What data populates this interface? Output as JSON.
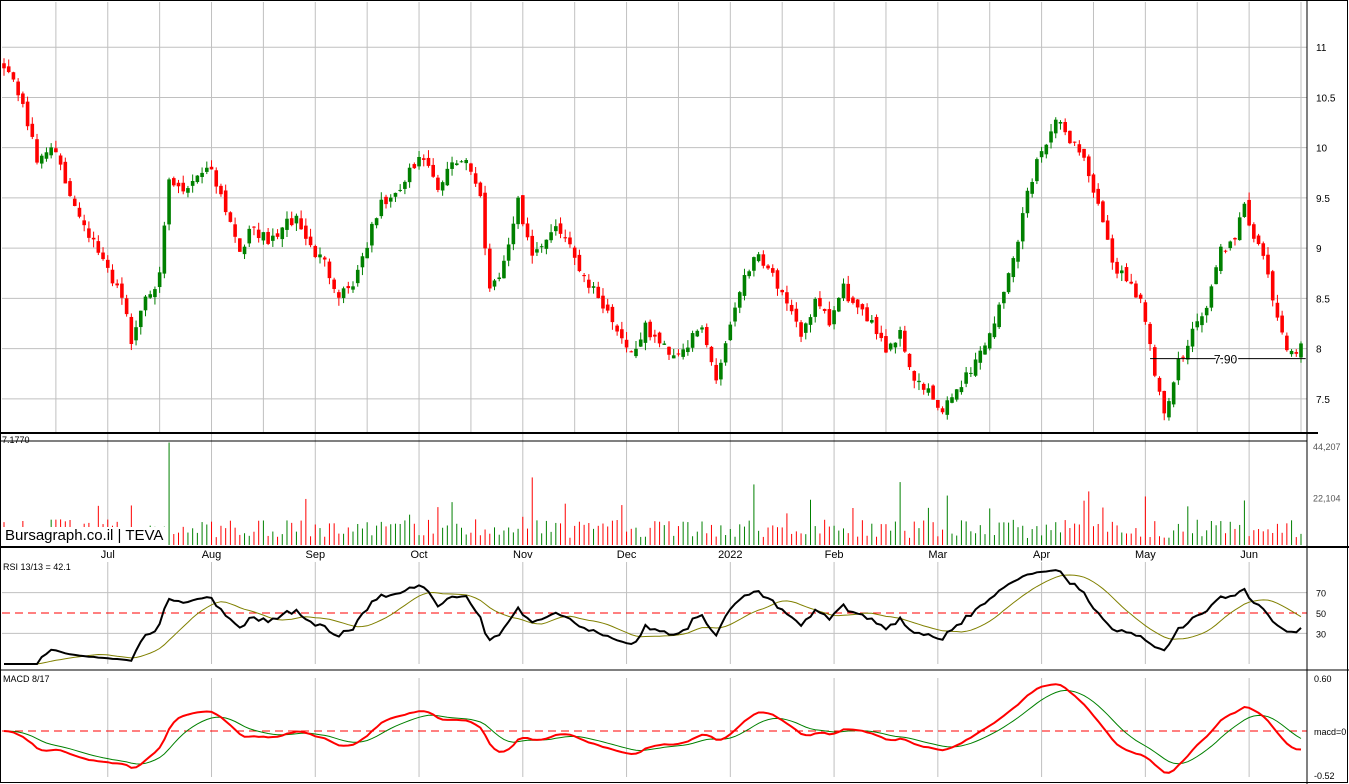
{
  "chart_data": [
    {
      "type": "candlestick",
      "ticker": "TEVA",
      "y_ticks": [
        "11",
        "10.5",
        "10",
        "9.5",
        "9",
        "8.5",
        "8",
        "7.5"
      ],
      "ylim": [
        7.17,
        11.45
      ],
      "low_label": "7.1770",
      "marker": {
        "label": "7.90",
        "value": 7.9
      },
      "x_labels": [
        "Jul",
        "Aug",
        "Sep",
        "Oct",
        "Nov",
        "Dec",
        "2022",
        "Feb",
        "Mar",
        "Apr",
        "May",
        "Jun"
      ],
      "x_label_days": [
        22,
        44,
        66,
        88,
        110,
        132,
        154,
        176,
        198,
        220,
        242,
        264
      ],
      "anchors": [
        [
          0,
          10.85
        ],
        [
          4,
          10.45
        ],
        [
          7,
          9.85
        ],
        [
          10,
          10.05
        ],
        [
          13,
          9.65
        ],
        [
          17,
          9.25
        ],
        [
          21,
          8.85
        ],
        [
          25,
          8.55
        ],
        [
          27,
          8.05
        ],
        [
          30,
          8.55
        ],
        [
          33,
          8.7
        ],
        [
          35,
          9.65
        ],
        [
          38,
          9.55
        ],
        [
          41,
          9.75
        ],
        [
          44,
          9.8
        ],
        [
          47,
          9.4
        ],
        [
          50,
          9.0
        ],
        [
          53,
          9.2
        ],
        [
          56,
          9.05
        ],
        [
          59,
          9.2
        ],
        [
          62,
          9.3
        ],
        [
          65,
          9.0
        ],
        [
          68,
          8.85
        ],
        [
          71,
          8.55
        ],
        [
          74,
          8.65
        ],
        [
          77,
          9.05
        ],
        [
          80,
          9.45
        ],
        [
          83,
          9.5
        ],
        [
          86,
          9.75
        ],
        [
          89,
          9.9
        ],
        [
          92,
          9.55
        ],
        [
          95,
          9.85
        ],
        [
          98,
          9.9
        ],
        [
          101,
          9.5
        ],
        [
          103,
          8.6
        ],
        [
          106,
          8.85
        ],
        [
          109,
          9.45
        ],
        [
          112,
          8.95
        ],
        [
          115,
          9.1
        ],
        [
          118,
          9.2
        ],
        [
          121,
          8.9
        ],
        [
          124,
          8.65
        ],
        [
          127,
          8.45
        ],
        [
          130,
          8.2
        ],
        [
          133,
          7.95
        ],
        [
          136,
          8.2
        ],
        [
          139,
          8.05
        ],
        [
          142,
          7.95
        ],
        [
          145,
          8.05
        ],
        [
          148,
          8.2
        ],
        [
          151,
          7.7
        ],
        [
          154,
          8.25
        ],
        [
          157,
          8.75
        ],
        [
          160,
          8.95
        ],
        [
          163,
          8.75
        ],
        [
          166,
          8.4
        ],
        [
          169,
          8.15
        ],
        [
          172,
          8.45
        ],
        [
          175,
          8.25
        ],
        [
          178,
          8.6
        ],
        [
          181,
          8.35
        ],
        [
          184,
          8.3
        ],
        [
          187,
          8.0
        ],
        [
          190,
          8.15
        ],
        [
          193,
          7.7
        ],
        [
          196,
          7.55
        ],
        [
          199,
          7.35
        ],
        [
          202,
          7.6
        ],
        [
          205,
          7.8
        ],
        [
          208,
          8.05
        ],
        [
          211,
          8.4
        ],
        [
          214,
          8.9
        ],
        [
          217,
          9.55
        ],
        [
          220,
          10.0
        ],
        [
          223,
          10.25
        ],
        [
          226,
          10.1
        ],
        [
          229,
          9.9
        ],
        [
          232,
          9.4
        ],
        [
          235,
          8.85
        ],
        [
          238,
          8.7
        ],
        [
          241,
          8.5
        ],
        [
          244,
          7.75
        ],
        [
          246,
          7.3
        ],
        [
          249,
          7.85
        ],
        [
          252,
          8.2
        ],
        [
          255,
          8.4
        ],
        [
          258,
          9.0
        ],
        [
          261,
          9.05
        ],
        [
          263,
          9.45
        ],
        [
          265,
          9.1
        ],
        [
          268,
          8.75
        ],
        [
          270,
          8.25
        ],
        [
          272,
          8.0
        ]
      ]
    },
    {
      "type": "bar",
      "name": "volume",
      "y_ticks": [
        "44,207",
        "22,104"
      ],
      "ylim": [
        0,
        44207
      ]
    },
    {
      "type": "line",
      "name": "RSI",
      "label": "RSI 13/13 = 42.1",
      "y_ticks": [
        "70",
        "50",
        "30"
      ],
      "ylim": [
        0,
        100
      ],
      "reference": 50,
      "last_value": 42.1
    },
    {
      "type": "line",
      "name": "MACD",
      "label": "MACD 8/17",
      "y_ticks": [
        "0.60",
        "macd=0",
        "-0.52"
      ],
      "ylim": [
        -0.52,
        0.6
      ],
      "reference": 0
    }
  ],
  "site": "Bursagraph.co.il",
  "watermark": "Bursagraph.co.il | TEVA",
  "colors": {
    "up": "#008000",
    "down": "#ff0000",
    "grid": "#c0c0c0",
    "rsi_line": "#000000",
    "signal_line": "#808000",
    "macd_line": "#ff0000",
    "macd_signal": "#008000"
  }
}
